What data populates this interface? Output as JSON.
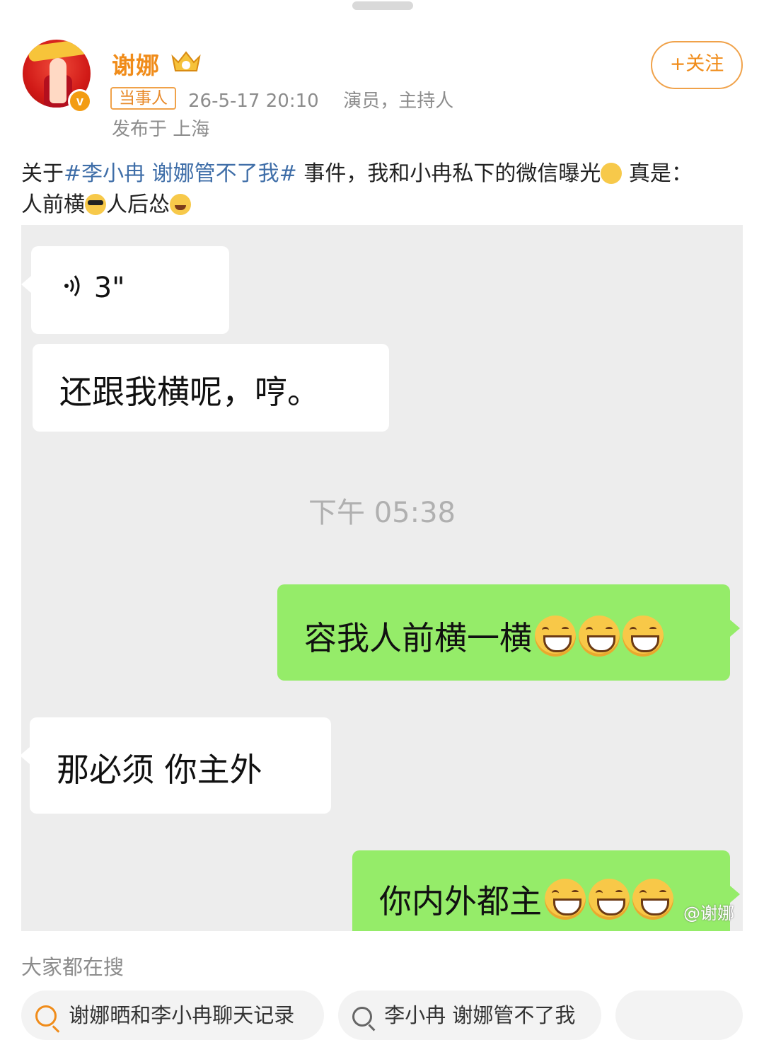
{
  "post": {
    "author": {
      "name": "谢娜",
      "tag": "当事人",
      "time": "26-5-17 20:10",
      "bio": "演员，主持人",
      "location": "发布于 上海"
    },
    "follow_label": "+关注",
    "text": {
      "prefix": "关于",
      "topic": "#李小冉 谢娜管不了我#",
      "middle": " 事件，我和小冉私下的微信曝光",
      "after_think": " 真是：",
      "line2_a": "人前横",
      "line2_b": "人后怂"
    }
  },
  "chat": {
    "voice_duration": "3\"",
    "msg1": "还跟我横呢，哼。",
    "timestamp": "下午 05:38",
    "msg2": "容我人前横一横",
    "msg3": "那必须 你主外",
    "msg4": "你内外都主",
    "watermark": "@谢娜"
  },
  "search": {
    "heading": "大家都在搜",
    "chips": [
      {
        "label": "谢娜晒和李小冉聊天记录",
        "icon": "hot-search-icon"
      },
      {
        "label": "李小冉 谢娜管不了我",
        "icon": "search-icon"
      },
      {
        "label": "",
        "icon": "search-icon"
      }
    ]
  },
  "colors": {
    "accent_orange": "#f08c1a",
    "topic_blue": "#3f6ea8",
    "bubble_green": "#95ec69",
    "chat_bg": "#ededed"
  }
}
